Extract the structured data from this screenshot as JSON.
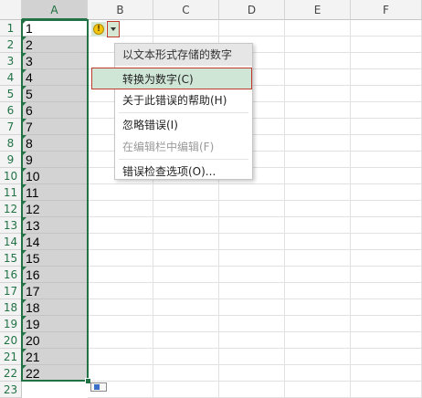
{
  "columns": [
    "A",
    "B",
    "C",
    "D",
    "E",
    "F"
  ],
  "rows": [
    "1",
    "2",
    "3",
    "4",
    "5",
    "6",
    "7",
    "8",
    "9",
    "10",
    "11",
    "12",
    "13",
    "14",
    "15",
    "16",
    "17",
    "18",
    "19",
    "20",
    "21",
    "22",
    "23"
  ],
  "cells_A": [
    "1",
    "2",
    "3",
    "4",
    "5",
    "6",
    "7",
    "8",
    "9",
    "10",
    "11",
    "12",
    "13",
    "14",
    "15",
    "16",
    "17",
    "18",
    "19",
    "20",
    "21",
    "22"
  ],
  "error_button": {
    "icon": "warning-icon",
    "symbol": "!"
  },
  "menu": {
    "header": "以文本形式存储的数字",
    "items": [
      {
        "label": "转换为数字(C)",
        "state": "highlighted"
      },
      {
        "label": "关于此错误的帮助(H)",
        "state": "normal"
      },
      {
        "label": "忽略错误(I)",
        "state": "normal"
      },
      {
        "label": "在编辑栏中编辑(F)",
        "state": "disabled"
      },
      {
        "label": "错误检查选项(O)...",
        "state": "normal"
      }
    ]
  },
  "colors": {
    "accent": "#217346",
    "selection_fill": "#d3d3d3",
    "highlight": "#cfe6d6",
    "outline_red": "#c0392b"
  }
}
